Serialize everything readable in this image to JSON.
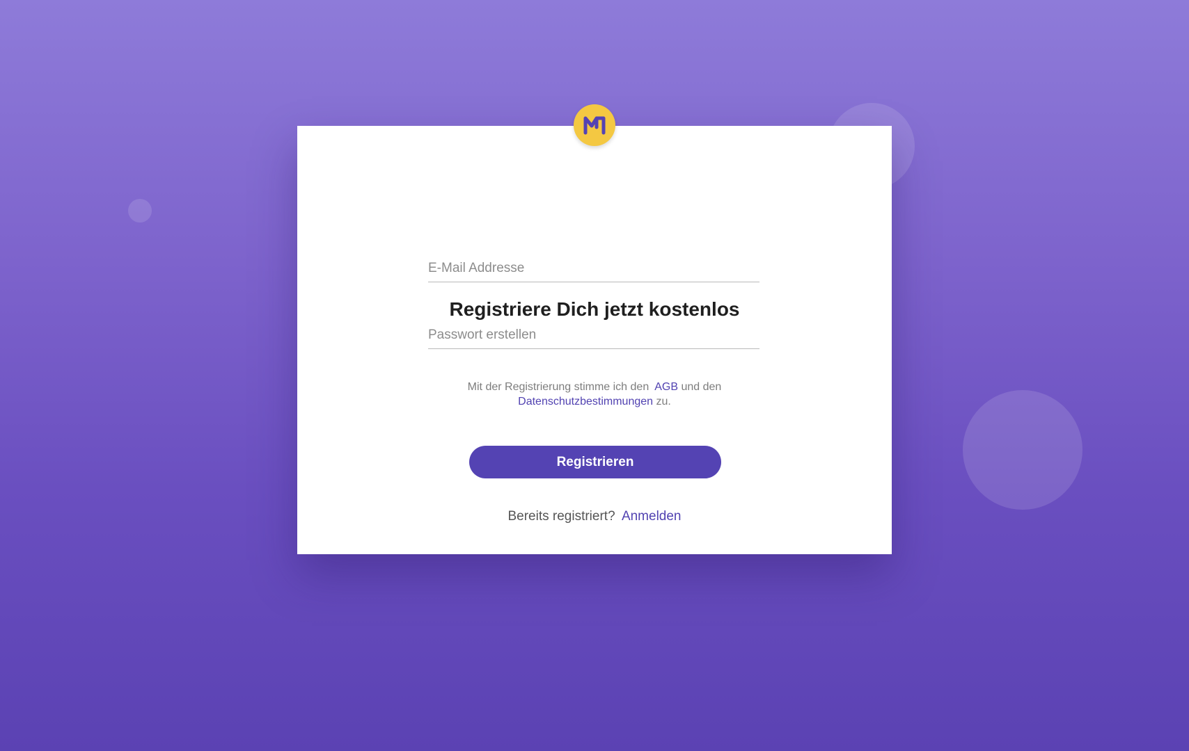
{
  "colors": {
    "background_top": "#8e7bd9",
    "background_bottom": "#5b42b3",
    "card": "#ffffff",
    "accent": "#5443b3",
    "logo_bg": "#f4c842",
    "logo_mark": "#5443b3"
  },
  "logo": {
    "icon": "m-logo-icon"
  },
  "form": {
    "title": "Registriere Dich jetzt kostenlos",
    "email_placeholder": "E-Mail Addresse",
    "email_value": "",
    "password_placeholder": "Passwort erstellen",
    "password_value": "",
    "terms_prefix": "Mit der Registrierung stimme ich den",
    "terms_agb": "AGB",
    "terms_middle": "und den",
    "terms_privacy": "Datenschutzbestimmungen",
    "terms_suffix": "zu.",
    "submit_label": "Registrieren",
    "login_prompt": "Bereits registriert?",
    "login_link": "Anmelden"
  }
}
